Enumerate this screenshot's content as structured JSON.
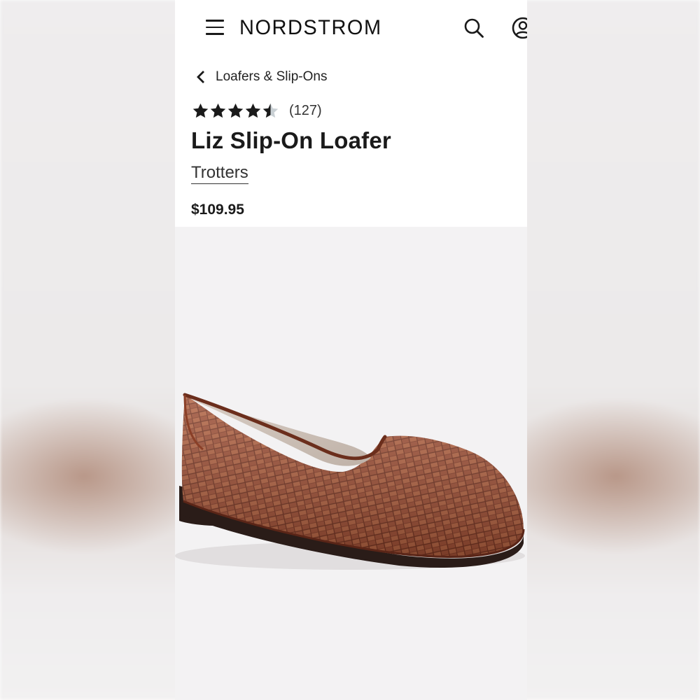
{
  "header": {
    "logo_text": "NORDSTROM",
    "icons": [
      "menu-icon",
      "search-icon",
      "account-icon"
    ]
  },
  "breadcrumb": {
    "label": "Loafers & Slip-Ons",
    "icon": "chevron-left-icon"
  },
  "product": {
    "rating": 4.5,
    "rating_max": 5,
    "review_count": "(127)",
    "title": "Liz Slip-On Loafer",
    "brand": "Trotters",
    "price": "$109.95",
    "image_subject": "brown woven leather slip-on loafer"
  },
  "colors": {
    "star_filled": "#1a1a1a",
    "star_empty": "#c9d0d4",
    "leather": "#9a4a32",
    "sole": "#2a1c18",
    "image_bg": "#f3f2f3"
  }
}
